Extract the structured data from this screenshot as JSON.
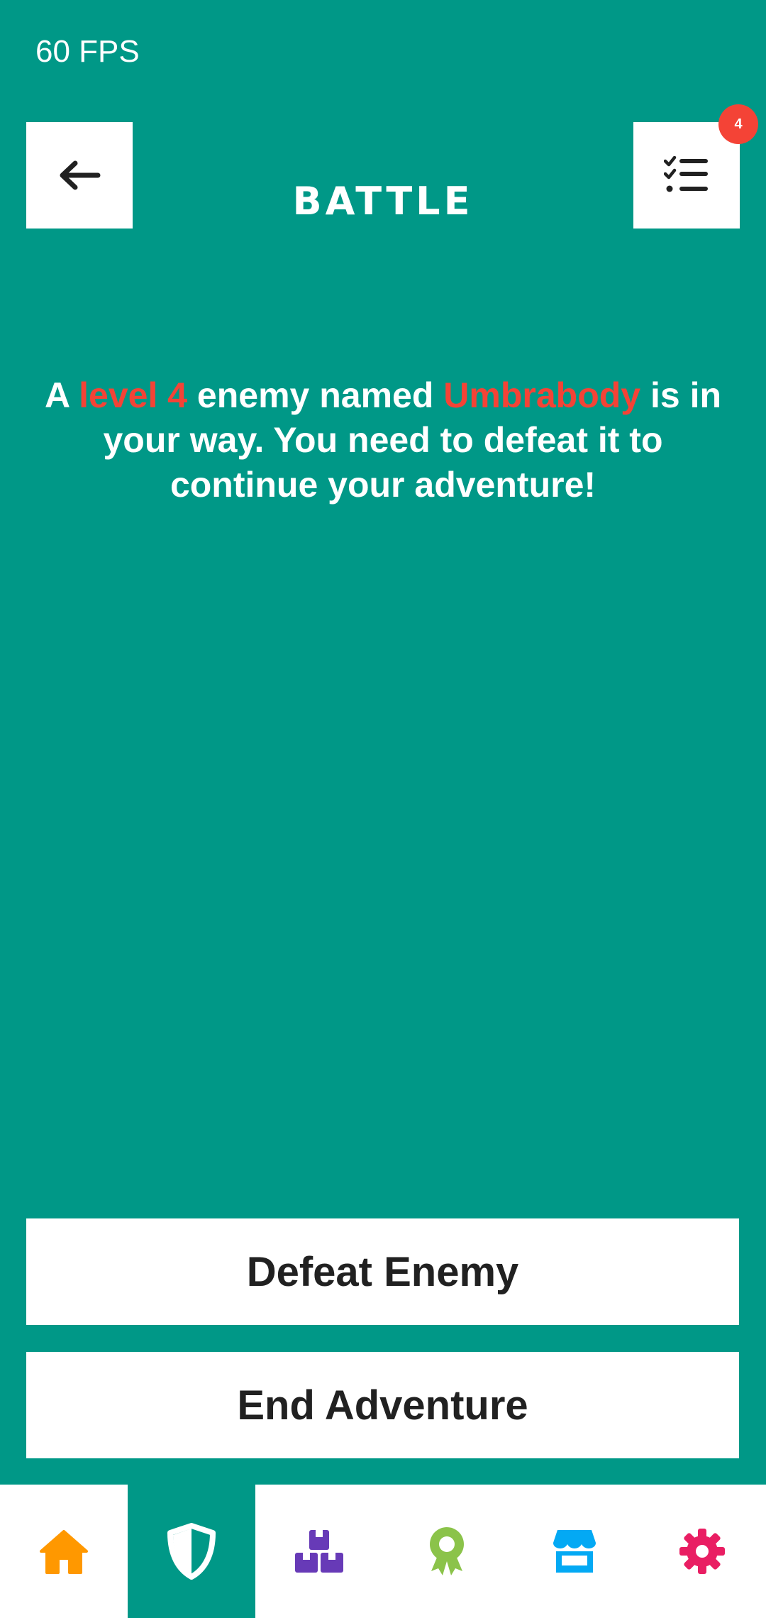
{
  "status": {
    "fps": "60 FPS"
  },
  "header": {
    "title": "BATTLE",
    "back_icon": "arrow-left-icon",
    "tasks_icon": "checklist-icon",
    "tasks_badge": "4"
  },
  "story": {
    "part1": "A ",
    "level": "level 4",
    "part2": " enemy named ",
    "enemy": "Umbrabody",
    "part3": " is in your way. You need to defeat it to continue your adventure!"
  },
  "actions": {
    "defeat_label": "Defeat Enemy",
    "end_label": "End Adventure"
  },
  "bottom_nav": {
    "items": [
      {
        "icon": "home-icon",
        "color": "#ff9800",
        "active": false
      },
      {
        "icon": "shield-icon",
        "color": "#ffffff",
        "active": true
      },
      {
        "icon": "boxes-icon",
        "color": "#673ab7",
        "active": false
      },
      {
        "icon": "award-icon",
        "color": "#8bc34a",
        "active": false
      },
      {
        "icon": "store-icon",
        "color": "#03a9f4",
        "active": false
      },
      {
        "icon": "gear-icon",
        "color": "#e91e63",
        "active": false
      }
    ]
  },
  "colors": {
    "background": "#009887",
    "highlight": "#f44336",
    "button_text": "#212121"
  }
}
